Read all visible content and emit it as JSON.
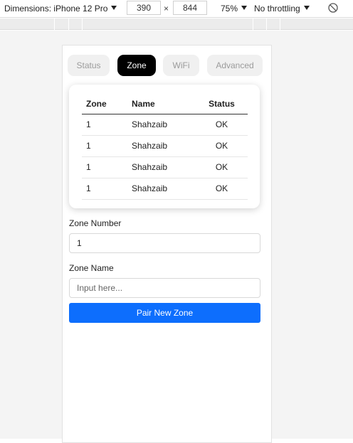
{
  "devtools": {
    "dimensions_label": "Dimensions: iPhone 12 Pro",
    "width": "390",
    "height": "844",
    "times": "×",
    "zoom": "75%",
    "throttling": "No throttling"
  },
  "tabs": [
    {
      "label": "Status",
      "active": false
    },
    {
      "label": "Zone",
      "active": true
    },
    {
      "label": "WiFi",
      "active": false
    },
    {
      "label": "Advanced",
      "active": false
    }
  ],
  "table": {
    "headers": [
      "Zone",
      "Name",
      "Status"
    ],
    "rows": [
      [
        "1",
        "Shahzaib",
        "OK"
      ],
      [
        "1",
        "Shahzaib",
        "OK"
      ],
      [
        "1",
        "Shahzaib",
        "OK"
      ],
      [
        "1",
        "Shahzaib",
        "OK"
      ]
    ]
  },
  "form": {
    "zone_number_label": "Zone Number",
    "zone_number_value": "1",
    "zone_name_label": "Zone Name",
    "zone_name_placeholder": "Input here...",
    "submit_label": "Pair New Zone"
  },
  "colors": {
    "active_tab": "#000000",
    "primary_button": "#0d6efd"
  }
}
